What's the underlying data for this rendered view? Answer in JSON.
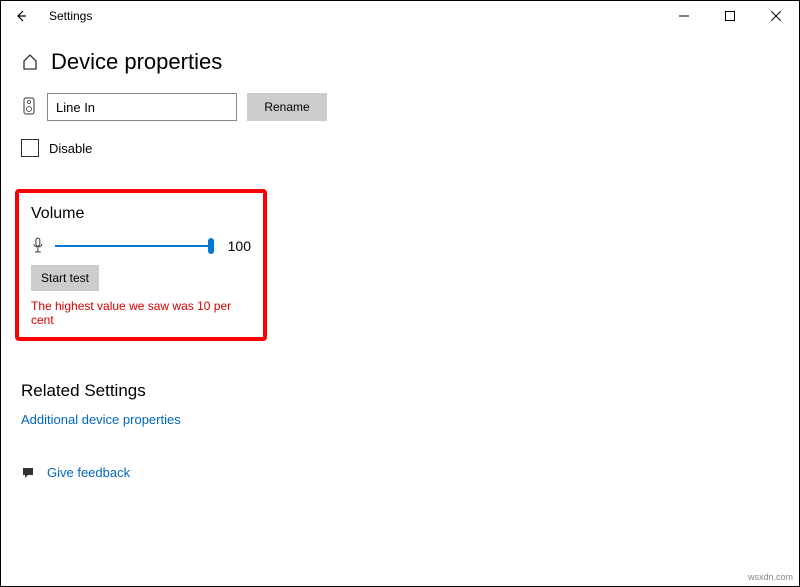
{
  "titlebar": {
    "app_name": "Settings"
  },
  "header": {
    "title": "Device properties"
  },
  "device": {
    "name_value": "Line In",
    "rename_label": "Rename",
    "disable_label": "Disable"
  },
  "volume": {
    "section_title": "Volume",
    "value": "100",
    "start_test_label": "Start test",
    "status_text": "The highest value we saw was 10 per cent"
  },
  "related": {
    "title": "Related Settings",
    "link_additional": "Additional device properties"
  },
  "feedback": {
    "link": "Give feedback"
  },
  "watermark": "wsxdn.com"
}
